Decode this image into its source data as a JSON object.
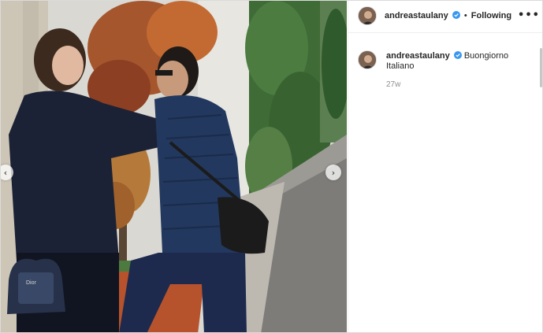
{
  "post": {
    "photo_alt": "",
    "nav_prev_glyph": "‹",
    "nav_next_glyph": "›"
  },
  "header": {
    "username": "andreastaulany",
    "separator": "•",
    "follow_label": "Following",
    "more_glyph": "•••"
  },
  "comment": {
    "username": "andreastaulany",
    "caption": "Buongiorno Italiano",
    "timestamp": "27w"
  },
  "colors": {
    "verified": "#3897f0",
    "text": "#262626",
    "muted": "#8e8e8e"
  }
}
